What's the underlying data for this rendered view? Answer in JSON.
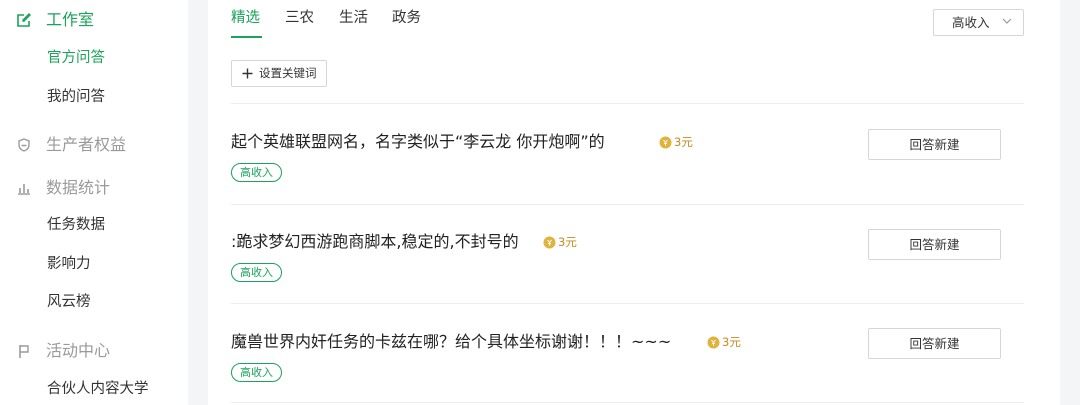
{
  "sidebar": {
    "groups": [
      {
        "label": "工作室",
        "icon": "edit-square-icon",
        "active": true
      },
      {
        "label": "生产者权益",
        "icon": "shield-icon"
      },
      {
        "label": "数据统计",
        "icon": "bar-chart-icon"
      },
      {
        "label": "活动中心",
        "icon": "flag-icon"
      }
    ],
    "items": [
      {
        "label": "官方问答",
        "active": true
      },
      {
        "label": "我的问答"
      },
      {
        "label": "任务数据"
      },
      {
        "label": "影响力"
      },
      {
        "label": "风云榜"
      },
      {
        "label": "合伙人内容大学"
      }
    ]
  },
  "tabs": [
    {
      "label": "精选",
      "active": true
    },
    {
      "label": "三农"
    },
    {
      "label": "生活"
    },
    {
      "label": "政务"
    }
  ],
  "filter": {
    "selected": "高收入"
  },
  "keyword_button": {
    "label": "设置关键词"
  },
  "questions": [
    {
      "title": "起个英雄联盟网名，名字类似于“李云龙 你开炮啊”的",
      "reward": "3元",
      "tag": "高收入",
      "action": "回答新建"
    },
    {
      "title": ":跪求梦幻西游跑商脚本,稳定的,不封号的",
      "reward": "3元",
      "tag": "高收入",
      "action": "回答新建"
    },
    {
      "title": "魔兽世界内奸任务的卡兹在哪？给个具体坐标谢谢！！！~~~",
      "reward": "3元",
      "tag": "高收入",
      "action": "回答新建"
    }
  ],
  "colors": {
    "accent": "#1aa35a",
    "coin": "#e2b33c",
    "reward_text": "#c98a1e"
  }
}
